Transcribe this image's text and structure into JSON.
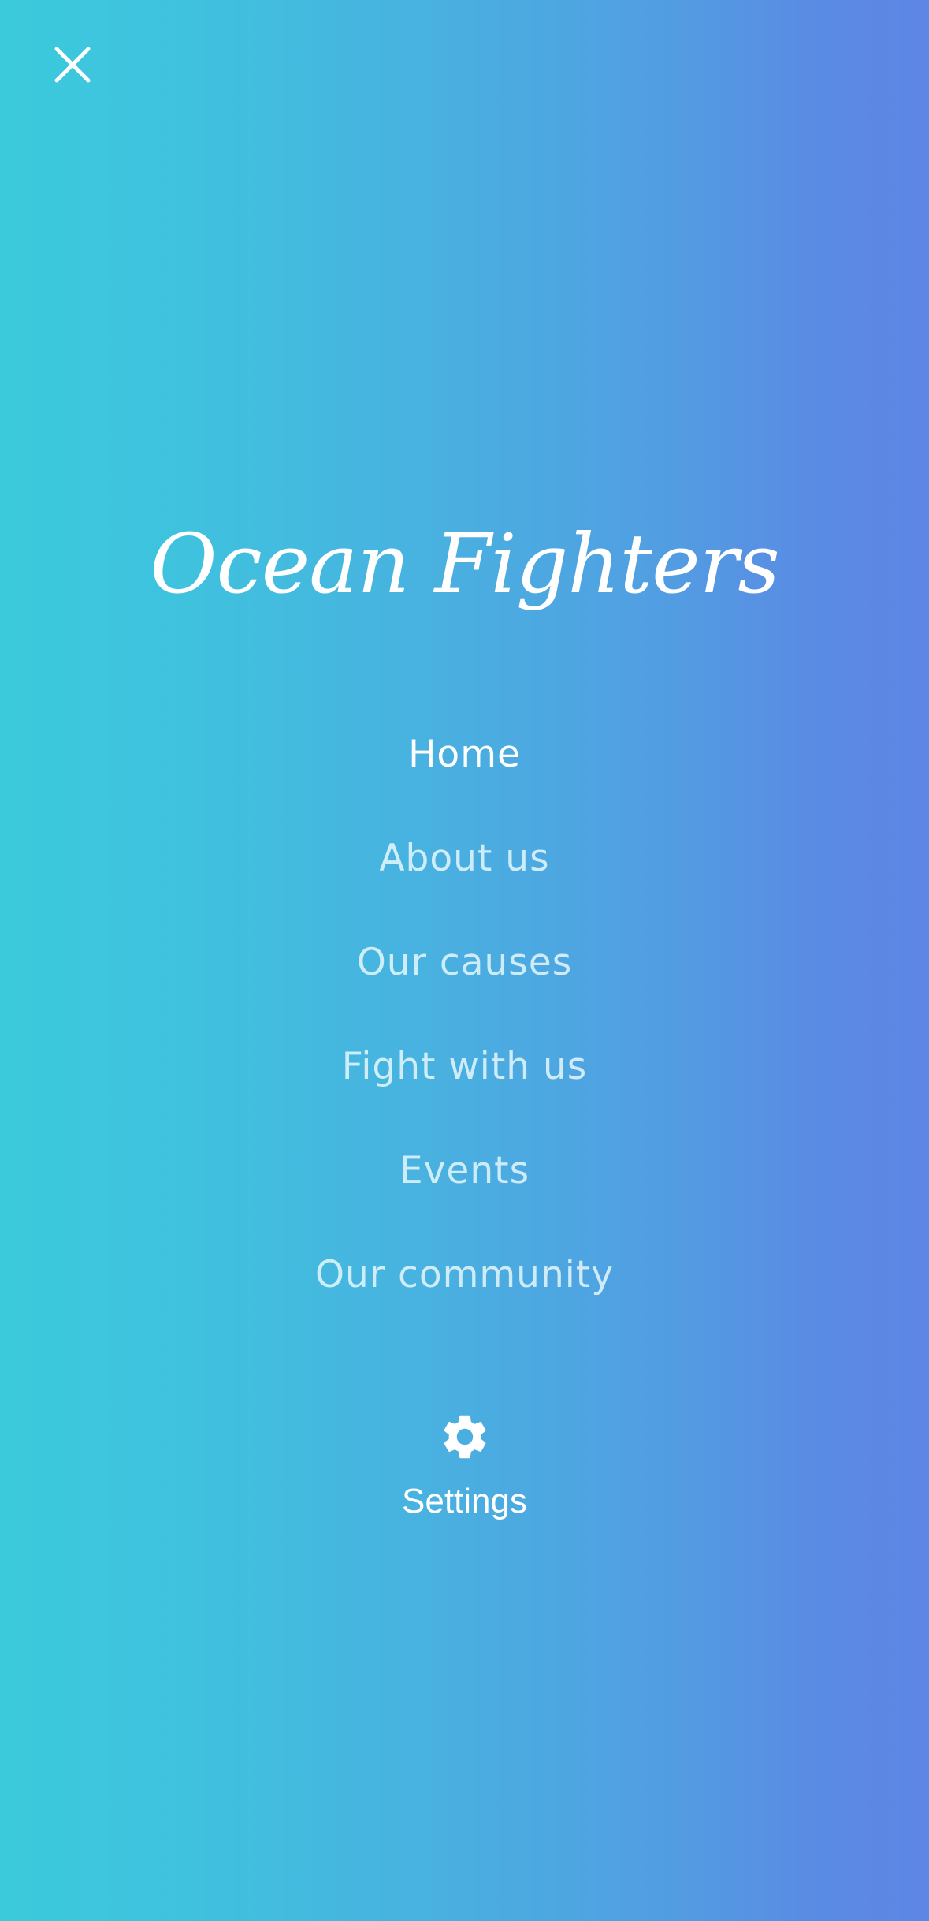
{
  "header": {
    "close_icon": "close-icon"
  },
  "brand": {
    "title": "Ocean Fighters"
  },
  "nav": {
    "items": [
      {
        "label": "Home",
        "active": true
      },
      {
        "label": "About us",
        "active": false
      },
      {
        "label": "Our causes",
        "active": false
      },
      {
        "label": "Fight with us",
        "active": false
      },
      {
        "label": "Events",
        "active": false
      },
      {
        "label": "Our community",
        "active": false
      }
    ]
  },
  "settings": {
    "icon": "gear-icon",
    "label": "Settings"
  },
  "colors": {
    "gradient_start": "#3bcadc",
    "gradient_end": "#5e86e4",
    "text_active": "#ffffff",
    "text_inactive": "#ebfafc"
  }
}
